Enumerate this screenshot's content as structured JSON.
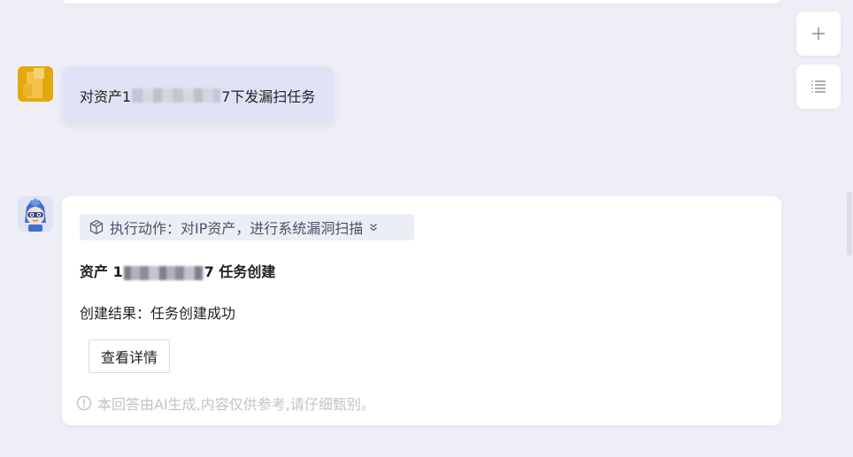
{
  "user_message": {
    "prefix": "对资产1",
    "suffix": "7下发漏扫任务"
  },
  "bot_message": {
    "action_chip": "执行动作：对IP资产，进行系统漏洞扫描",
    "task_title_prefix": "资产 1",
    "task_title_suffix": "7 任务创建",
    "result_text": "创建结果：任务创建成功",
    "detail_button": "查看详情",
    "disclaimer": "本回答由AI生成,内容仅供参考,请仔细甄别。"
  },
  "sidebar": {
    "new_chat_icon": "plus-icon",
    "history_icon": "list-icon"
  },
  "colors": {
    "background": "#eeeff6",
    "user_bubble": "#dfe3f5",
    "user_avatar": "#e5a80c",
    "chip_background": "#eceef6",
    "disclaimer_text": "#c2c3c8"
  }
}
